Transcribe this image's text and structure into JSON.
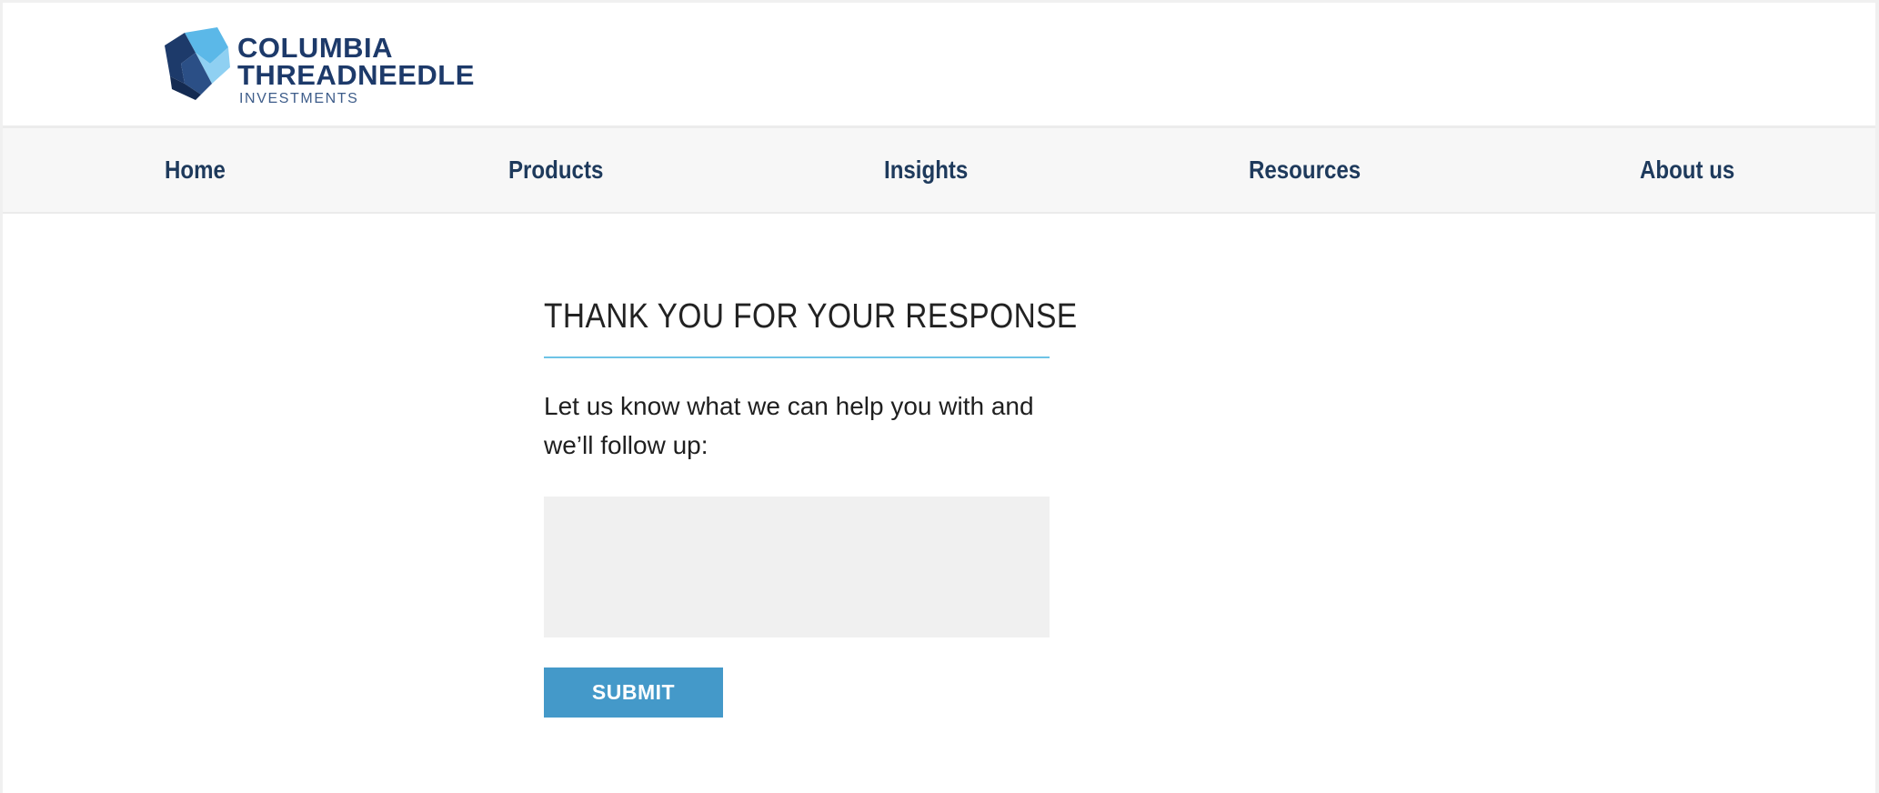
{
  "brand": {
    "line1": "COLUMBIA",
    "line2": "THREADNEEDLE",
    "line3": "INVESTMENTS",
    "colors": {
      "navy": "#1d3a6a",
      "light_blue": "#5bb8e8",
      "accent_rule": "#6ec3e6",
      "button": "#4499c9"
    }
  },
  "nav": {
    "items": [
      {
        "label": "Home"
      },
      {
        "label": "Products"
      },
      {
        "label": "Insights"
      },
      {
        "label": "Resources"
      },
      {
        "label": "About us"
      }
    ]
  },
  "main": {
    "title": "THANK YOU FOR YOUR RESPONSE",
    "intro": "Let us know what we can help you with and we’ll follow up:",
    "feedback": {
      "value": "",
      "placeholder": ""
    },
    "submit_label": "SUBMIT"
  }
}
